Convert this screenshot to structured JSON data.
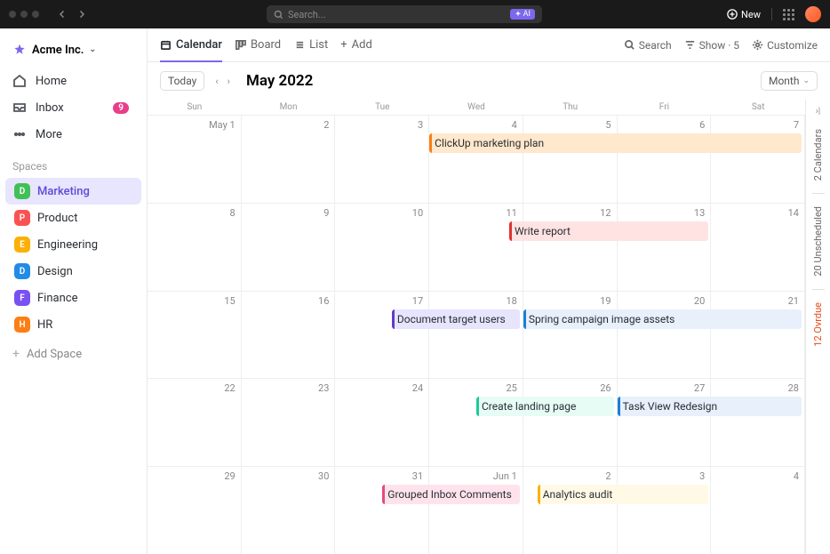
{
  "topbar": {
    "search_placeholder": "Search...",
    "ai_label": "AI",
    "new_label": "New"
  },
  "workspace": {
    "name": "Acme Inc."
  },
  "nav": {
    "home": "Home",
    "inbox": "Inbox",
    "inbox_count": "9",
    "more": "More"
  },
  "sidebar": {
    "section": "Spaces",
    "items": [
      {
        "letter": "D",
        "label": "Marketing",
        "color": "#40c057",
        "active": true
      },
      {
        "letter": "P",
        "label": "Product",
        "color": "#fa5252"
      },
      {
        "letter": "E",
        "label": "Engineering",
        "color": "#fab005"
      },
      {
        "letter": "D",
        "label": "Design",
        "color": "#228be6"
      },
      {
        "letter": "F",
        "label": "Finance",
        "color": "#7950f2"
      },
      {
        "letter": "H",
        "label": "HR",
        "color": "#fd7e14"
      }
    ],
    "add_space": "Add Space"
  },
  "tabs": {
    "calendar": "Calendar",
    "board": "Board",
    "list": "List",
    "add": "Add"
  },
  "toolbar": {
    "search": "Search",
    "show": "Show · 5",
    "customize": "Customize"
  },
  "calendar": {
    "today": "Today",
    "month_label": "May 2022",
    "view": "Month",
    "days": [
      "Sun",
      "Mon",
      "Tue",
      "Wed",
      "Thu",
      "Fri",
      "Sat"
    ],
    "weeks": [
      [
        "May 1",
        "2",
        "3",
        "4",
        "5",
        "6",
        "7"
      ],
      [
        "8",
        "9",
        "10",
        "11",
        "12",
        "13",
        "14"
      ],
      [
        "15",
        "16",
        "17",
        "18",
        "19",
        "20",
        "21"
      ],
      [
        "22",
        "23",
        "24",
        "25",
        "26",
        "27",
        "28"
      ],
      [
        "29",
        "30",
        "31",
        "Jun 1",
        "2",
        "3",
        "4"
      ]
    ],
    "events": [
      {
        "week": 0,
        "label": "ClickUp marketing plan",
        "start": 3,
        "span": 4,
        "bg": "#ffe8cc",
        "bar": "#fd7e14"
      },
      {
        "week": 1,
        "label": "Write report",
        "start": 3.85,
        "span": 2.15,
        "bg": "#ffe3e3",
        "bar": "#e03131"
      },
      {
        "week": 2,
        "label": "Document target users",
        "start": 2.6,
        "span": 1.4,
        "bg": "#e7e4fd",
        "bar": "#5f3dc4"
      },
      {
        "week": 2,
        "label": "Spring campaign image assets",
        "start": 4,
        "span": 3,
        "bg": "#e7f0fb",
        "bar": "#1c7ed6"
      },
      {
        "week": 3,
        "label": "Create landing page",
        "start": 3.5,
        "span": 1.5,
        "bg": "#e6fcf5",
        "bar": "#20c997"
      },
      {
        "week": 3,
        "label": "Task View Redesign",
        "start": 5,
        "span": 2,
        "bg": "#e7f0fb",
        "bar": "#1c7ed6"
      },
      {
        "week": 4,
        "label": "Grouped Inbox Comments",
        "start": 2.5,
        "span": 1.5,
        "bg": "#ffe3ec",
        "bar": "#e64980"
      },
      {
        "week": 4,
        "label": "Analytics audit",
        "start": 4.15,
        "span": 1.85,
        "bg": "#fff9e6",
        "bar": "#fab005"
      }
    ]
  },
  "side_panel": {
    "calendars": "2 Calendars",
    "unscheduled": "20 Unscheduled",
    "overdue": "12 Ovrdue"
  }
}
